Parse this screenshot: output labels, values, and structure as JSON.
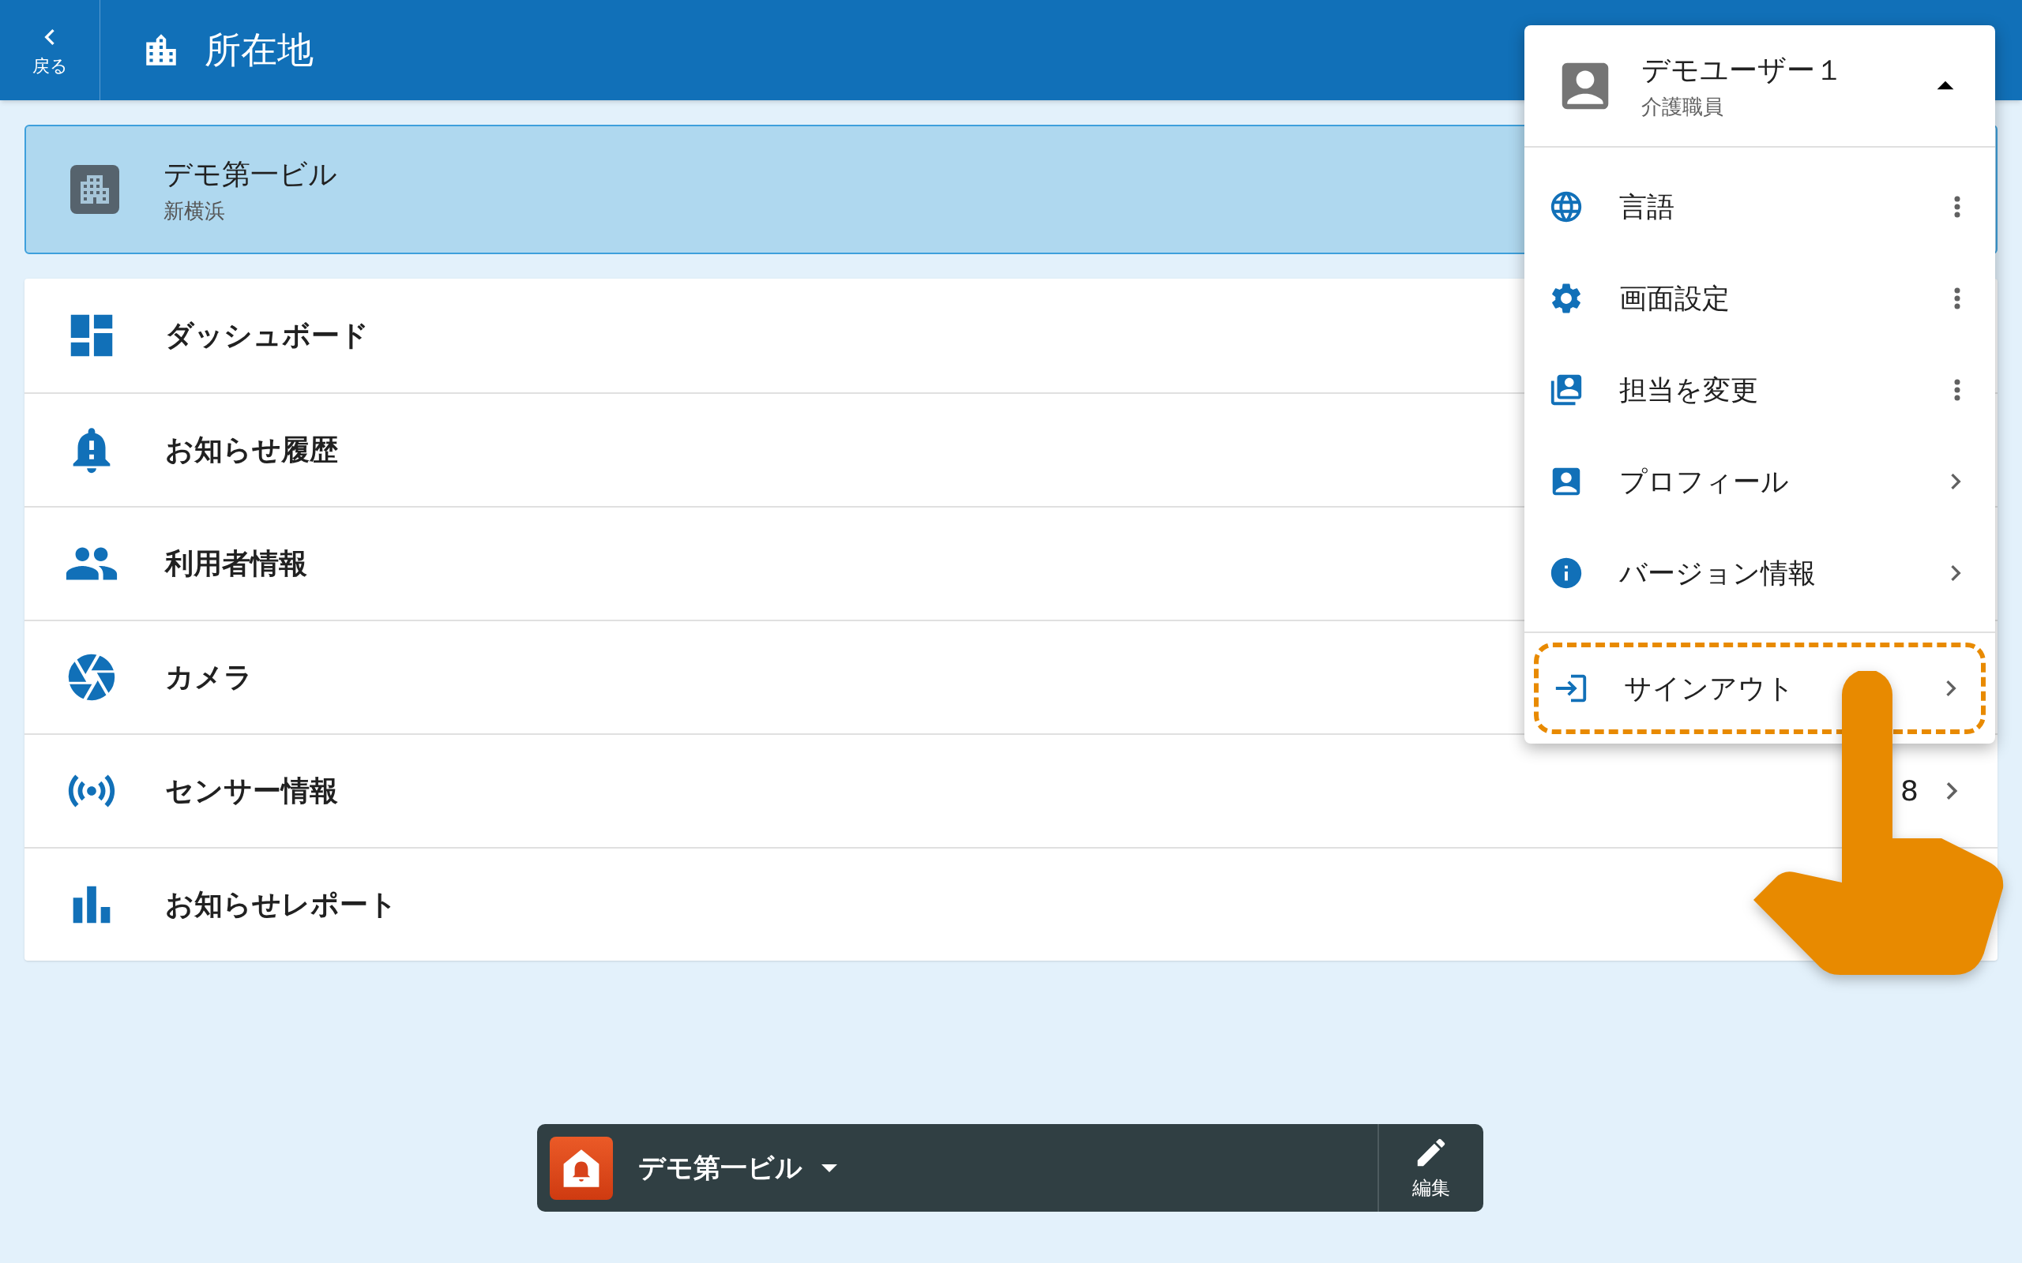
{
  "header": {
    "back_label": "戻る",
    "title": "所在地"
  },
  "location": {
    "name": "デモ第一ビル",
    "area": "新横浜",
    "selected": true
  },
  "menu_rows": [
    {
      "label": "ダッシュボード"
    },
    {
      "label": "お知らせ履歴"
    },
    {
      "label": "利用者情報"
    },
    {
      "label": "カメラ"
    },
    {
      "label": "センサー情報",
      "count": "8"
    },
    {
      "label": "お知らせレポート"
    }
  ],
  "user_menu": {
    "user_name": "デモユーザー１",
    "role": "介護職員",
    "expanded": true,
    "items": [
      {
        "label": "言語",
        "kind": "more",
        "highlighted": false
      },
      {
        "label": "画面設定",
        "kind": "more",
        "highlighted": false
      },
      {
        "label": "担当を変更",
        "kind": "more",
        "highlighted": false
      },
      {
        "label": "プロフィール",
        "kind": "link",
        "highlighted": false
      },
      {
        "label": "バージョン情報",
        "kind": "link",
        "highlighted": false
      }
    ],
    "footer_item": {
      "label": "サインアウト",
      "kind": "link",
      "highlighted": true
    }
  },
  "bottom_bar": {
    "facility": "デモ第一ビル",
    "edit_label": "編集"
  }
}
